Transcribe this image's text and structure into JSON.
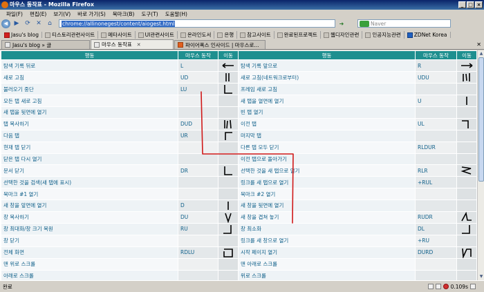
{
  "window": {
    "title": "마우스 동작표 - Mozilla Firefox"
  },
  "menu": [
    "파일(F)",
    "편집(E)",
    "보기(V)",
    "바로 가기(S)",
    "북마크(B)",
    "도구(T)",
    "도움말(H)"
  ],
  "nav": {
    "url": "chrome://allinonegest/content/aiogest.html",
    "search_placeholder": "Naver"
  },
  "bookmarks": [
    {
      "label": "Jasu's blog",
      "icon": "a"
    },
    {
      "label": "티스토리관련사이트",
      "icon": "folder"
    },
    {
      "label": "메타사이트",
      "icon": "folder"
    },
    {
      "label": "UI관련사이트",
      "icon": "folder"
    },
    {
      "label": "온라인도서",
      "icon": "folder"
    },
    {
      "label": "은행",
      "icon": "folder"
    },
    {
      "label": "참고사이트",
      "icon": "folder"
    },
    {
      "label": "완료된프로젝트",
      "icon": "folder"
    },
    {
      "label": "웹디자인관련",
      "icon": "folder"
    },
    {
      "label": "인공지능관련",
      "icon": "folder"
    },
    {
      "label": "ZDNet Korea",
      "icon": "z"
    }
  ],
  "tabs": [
    {
      "label": "Jasu's blog » 글",
      "active": false
    },
    {
      "label": "마우스 동작표",
      "active": true
    },
    {
      "label": "파이어폭스 인사이드 | 마우스로...",
      "active": false
    }
  ],
  "table": {
    "headers": [
      "행동",
      "마우스 동작",
      "이동",
      "행동",
      "마우스 동작",
      "이동"
    ],
    "rows": [
      {
        "l": [
          "탐색 기록 뒤로",
          "L",
          "arrow-left"
        ],
        "r": [
          "탐색 기록 앞으로",
          "R",
          "arrow-right"
        ]
      },
      {
        "l": [
          "새로 고침",
          "UD",
          "up-down"
        ],
        "r": [
          "새로 고침(네트워크로부터)",
          "UDU",
          "up-down-up"
        ]
      },
      {
        "l": [
          "불러오기 중단",
          "LU",
          "left-up"
        ],
        "r": [
          "프레임 새로 고침",
          "",
          ""
        ]
      },
      {
        "l": [
          "모든 탭 새로 고침",
          "",
          ""
        ],
        "r": [
          "새 탭을 열면에 열기",
          "U",
          "up"
        ]
      },
      {
        "l": [
          "새 탭을 뒷면에 열기",
          "",
          ""
        ],
        "r": [
          "빈 탭 열기",
          "",
          ""
        ]
      },
      {
        "l": [
          "탭 복사하기",
          "DUD",
          "down-up-down"
        ],
        "r": [
          "이전 탭",
          "UL",
          "up-left"
        ]
      },
      {
        "l": [
          "다음 탭",
          "UR",
          "up-right"
        ],
        "r": [
          "마지막 탭",
          "",
          ""
        ]
      },
      {
        "l": [
          "현재 탭 닫기",
          "",
          ""
        ],
        "r": [
          "다른 탭 모두 닫기",
          "RLDUR",
          ""
        ]
      },
      {
        "l": [
          "닫은 탭 다시 열기",
          "",
          ""
        ],
        "r": [
          "이전 탭으로 돌아가기",
          "",
          ""
        ]
      },
      {
        "l": [
          "문서 닫기",
          "DR",
          "down-right"
        ],
        "r": [
          "선택한 것을 새 탭으로 열기",
          "RLR",
          "right-left-right"
        ]
      },
      {
        "l": [
          "선택한 것을 검색(새 탭에 표시)",
          "",
          ""
        ],
        "r": [
          "링크를 새 탭으로 열기",
          "+RUL",
          ""
        ]
      },
      {
        "l": [
          "북마크 #1 열기",
          "",
          ""
        ],
        "r": [
          "북마크 #2 열기",
          "",
          ""
        ]
      },
      {
        "l": [
          "새 창을 앞면에 열기",
          "D",
          "down"
        ],
        "r": [
          "새 창을 뒷면에 열기",
          "",
          ""
        ]
      },
      {
        "l": [
          "창 복사하기",
          "DU",
          "down-up"
        ],
        "r": [
          "새 창을 겹쳐 놓기",
          "RUDR",
          "right-up-down-right"
        ]
      },
      {
        "l": [
          "창 최대화/창 크기 복원",
          "RU",
          "right-up"
        ],
        "r": [
          "창 최소화",
          "DL",
          "down-left"
        ]
      },
      {
        "l": [
          "창 닫기",
          "",
          ""
        ],
        "r": [
          "링크를 새 창으로 열기",
          "+RU",
          ""
        ]
      },
      {
        "l": [
          "전체 화면",
          "RDLU",
          "right-down-left-up"
        ],
        "r": [
          "시작 페이지 열기",
          "DURD",
          "down-up-right-down"
        ]
      },
      {
        "l": [
          "맨 위로 스크롤",
          "",
          ""
        ],
        "r": [
          "맨 아래로 스크롤",
          "",
          ""
        ]
      },
      {
        "l": [
          "아래로 스크롤",
          "",
          ""
        ],
        "r": [
          "위로 스크롤",
          "",
          ""
        ]
      }
    ]
  },
  "status": {
    "left": "완료",
    "time": "0.109s"
  },
  "colors": {
    "header": "#1e8f8f",
    "link": "#10608a",
    "annotation": "#d01818"
  }
}
